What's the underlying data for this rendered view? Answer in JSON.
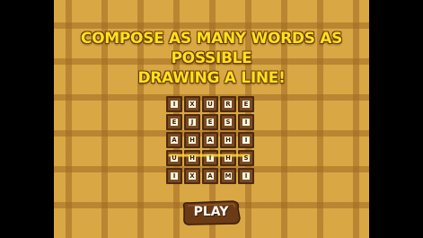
{
  "instruction": {
    "line1": "COMPOSE AS MANY WORDS AS POSSIBLE",
    "line2": "DRAWING A LINE!"
  },
  "board": {
    "rows": [
      [
        "I",
        "X",
        "U",
        "R",
        "E"
      ],
      [
        "E",
        "J",
        "E",
        "S",
        "I"
      ],
      [
        "A",
        "H",
        "A",
        "H",
        "I"
      ],
      [
        "U",
        "H",
        "I",
        "H",
        "S"
      ],
      [
        "I",
        "X",
        "A",
        "M",
        "I"
      ]
    ],
    "traced_row": 3
  },
  "play_button": {
    "label": "PLAY"
  },
  "colors": {
    "background": "#d9a845",
    "grid_lines": "#a0692 3",
    "title_text": "#ffe21a",
    "tile": "#7a4a1f",
    "tile_face": "#fff6e0",
    "trace_line": "#ffd43a",
    "button": "#6b3b15"
  }
}
